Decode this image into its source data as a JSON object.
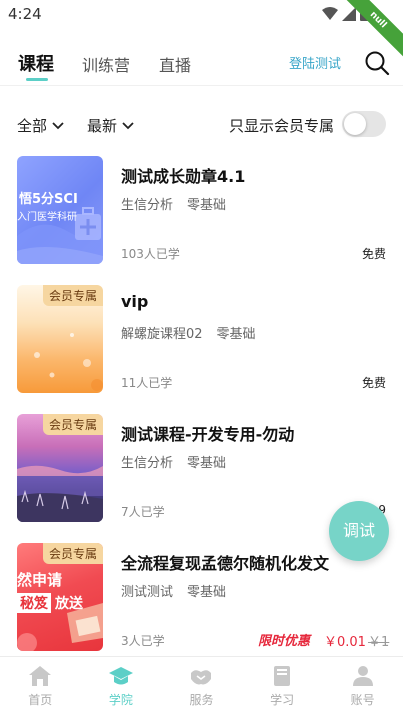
{
  "status": {
    "time": "4:24",
    "debug_banner": "null"
  },
  "tabs": [
    {
      "label": "课程",
      "active": true
    },
    {
      "label": "训练营",
      "active": false
    },
    {
      "label": "直播",
      "active": false
    }
  ],
  "header": {
    "login_test": "登陆测试",
    "search_icon": "search-icon"
  },
  "filters": {
    "category": "全部",
    "sort": "最新",
    "member_only_label": "只显示会员专属",
    "member_only_on": false
  },
  "courses": [
    {
      "title": "测试成长勋章4.1",
      "tags": [
        "生信分析",
        "零基础"
      ],
      "learners": "103人已学",
      "price": "免费",
      "badge": "",
      "thumb_text": [
        "悟5分SCI",
        "入门医学科研"
      ]
    },
    {
      "title": "vip",
      "tags": [
        "解螺旋课程02",
        "零基础"
      ],
      "learners": "11人已学",
      "price": "免费",
      "badge": "会员专属",
      "thumb_text": []
    },
    {
      "title": "测试课程-开发专用-勿动",
      "tags": [
        "生信分析",
        "零基础"
      ],
      "learners": "7人已学",
      "price": "9",
      "badge": "会员专属",
      "thumb_text": []
    },
    {
      "title": "全流程复现孟德尔随机化发文",
      "tags": [
        "测试测试",
        "零基础"
      ],
      "learners": "3人已学",
      "promo_label": "限时优惠",
      "promo_price": "￥0.01",
      "original_price": "￥1",
      "badge": "会员专属",
      "thumb_text": [
        "然申请",
        "秘笈",
        "放送"
      ]
    }
  ],
  "fab": {
    "label": "调试"
  },
  "bottom_nav": [
    {
      "label": "首页",
      "icon": "home-icon",
      "active": false
    },
    {
      "label": "学院",
      "icon": "graduation-cap-icon",
      "active": true
    },
    {
      "label": "服务",
      "icon": "handshake-icon",
      "active": false
    },
    {
      "label": "学习",
      "icon": "book-icon",
      "active": false
    },
    {
      "label": "账号",
      "icon": "user-icon",
      "active": false
    }
  ],
  "colors": {
    "accent": "#5ccfc7",
    "link": "#3aa6c9",
    "promo": "#e6283c",
    "badge_bg": "#f6d6a0"
  }
}
